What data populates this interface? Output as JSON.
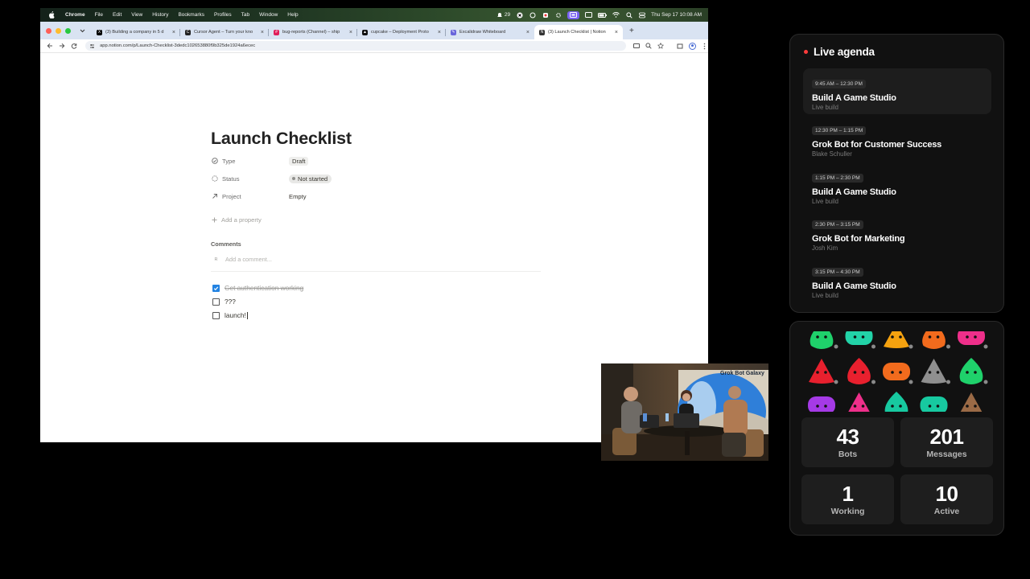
{
  "menubar": {
    "app": "Chrome",
    "items": [
      "File",
      "Edit",
      "View",
      "History",
      "Bookmarks",
      "Profiles",
      "Tab",
      "Window",
      "Help"
    ],
    "notification_count": "29",
    "datetime": "Thu Sep 17  10:08 AM"
  },
  "tabs": [
    {
      "title": "(3) Building a company in 5 d",
      "color": "#000000",
      "glyph": "X"
    },
    {
      "title": "Cursor Agent – Turn your kno",
      "color": "#222222",
      "glyph": "C"
    },
    {
      "title": "bug-reports (Channel) – ship",
      "color": "#e01e5a",
      "glyph": "#"
    },
    {
      "title": "cupcake – Deployment Proto",
      "color": "#111111",
      "glyph": "▲"
    },
    {
      "title": "Excalidraw Whiteboard",
      "color": "#6965db",
      "glyph": "✎"
    },
    {
      "title": "(3) Launch Checklist | Notion",
      "color": "#333333",
      "glyph": "N"
    }
  ],
  "url": "app.notion.com/p/Launch-Checklist-3dedc102653880f9b325de1924a6ecec",
  "page": {
    "title": "Launch Checklist",
    "properties": [
      {
        "name": "Type",
        "value": "Draft"
      },
      {
        "name": "Status",
        "value": "Not started"
      },
      {
        "name": "Project",
        "value": "Empty"
      }
    ],
    "add_property": "Add a property",
    "comments_label": "Comments",
    "comment_avatar": "R",
    "comment_placeholder": "Add a comment...",
    "todos": [
      {
        "text": "Get authentication working",
        "checked": true
      },
      {
        "text": "???",
        "checked": false
      },
      {
        "text": "launch!",
        "checked": false
      }
    ]
  },
  "webcam": {
    "sign": "Grok Bot Galaxy"
  },
  "agenda": {
    "title": "Live agenda",
    "items": [
      {
        "time": "9:45 AM – 12:30 PM",
        "title": "Build A Game Studio",
        "subtitle": "Live build",
        "current": true
      },
      {
        "time": "12:30 PM – 1:15 PM",
        "title": "Grok Bot for Customer Success",
        "subtitle": "Blake Schuller",
        "current": false
      },
      {
        "time": "1:15 PM – 2:30 PM",
        "title": "Build A Game Studio",
        "subtitle": "Live build",
        "current": false
      },
      {
        "time": "2:30 PM – 3:15 PM",
        "title": "Grok Bot for Marketing",
        "subtitle": "Josh Kim",
        "current": false
      },
      {
        "time": "3:15 PM – 4:30 PM",
        "title": "Build A Game Studio",
        "subtitle": "Live build",
        "current": false
      }
    ]
  },
  "bot_colors": [
    [
      "#1fd16b",
      "#22d3a8",
      "#f5a20f",
      "#f26b1d",
      "#ee2f8a"
    ],
    [
      "#e8202e",
      "#e8202e",
      "#f26b1d",
      "#8f8f8f",
      "#1fd16b"
    ],
    [
      "#a53ae6",
      "#ee2f8a",
      "#17c9a0",
      "#17c9a0",
      "#9a6a46"
    ]
  ],
  "stats": [
    {
      "value": "43",
      "label": "Bots"
    },
    {
      "value": "201",
      "label": "Messages"
    },
    {
      "value": "1",
      "label": "Working"
    },
    {
      "value": "10",
      "label": "Active"
    }
  ],
  "colors": {
    "agenda_dot": "#ff3b3b",
    "checkbox_checked": "#2383e2",
    "mac_close": "#ff5f57",
    "mac_min": "#febc2e",
    "mac_max": "#28c840"
  }
}
